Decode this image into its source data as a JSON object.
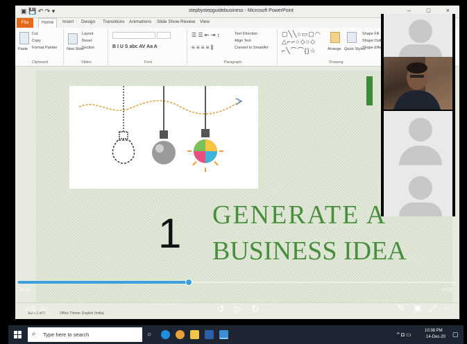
{
  "window": {
    "title": "stepbystepguidebusiness - Microsoft PowerPoint",
    "controls": "–  □  ×"
  },
  "tabs": [
    "File",
    "Home",
    "Insert",
    "Design",
    "Transitions",
    "Animations",
    "Slide Show",
    "Review",
    "View"
  ],
  "ribbon": {
    "clipboard": {
      "paste": "Paste",
      "cut": "Cut",
      "copy": "Copy",
      "format_painter": "Format Painter",
      "label": "Clipboard"
    },
    "slides": {
      "new_slide": "New Slide",
      "layout": "Layout",
      "reset": "Reset",
      "section": "Section",
      "label": "Slides"
    },
    "font": {
      "label": "Font",
      "styles": "B  I  U  S  abc  AV  Aa  A"
    },
    "paragraph": {
      "text_direction": "Text Direction",
      "align_text": "Align Text",
      "smartart": "Convert to SmartArt",
      "label": "Paragraph"
    },
    "drawing": {
      "arrange": "Arrange",
      "quick_styles": "Quick Styles",
      "shape_fill": "Shape Fill",
      "shape_outline": "Shape Outline",
      "shape_effects": "Shape Effects",
      "label": "Drawing"
    }
  },
  "slide": {
    "number": "1",
    "title_line1": "GENERATE A",
    "title_line2": "BUSINESS IDEA"
  },
  "statusbar": {
    "slide_info": "Slide 1 of 1",
    "theme": "Office Theme",
    "language": "English (India)"
  },
  "video": {
    "elapsed": "04:18",
    "total": "10:57",
    "progress": 0.39
  },
  "taskbar": {
    "search_placeholder": "Type here to search",
    "time": "10:38 PM",
    "date": "14-Dec-20"
  },
  "colors": {
    "title_green": "#4a8d3f",
    "accent_blue": "#3b9fe0",
    "file_tab": "#e46b1e",
    "taskbar": "#1d2532"
  }
}
